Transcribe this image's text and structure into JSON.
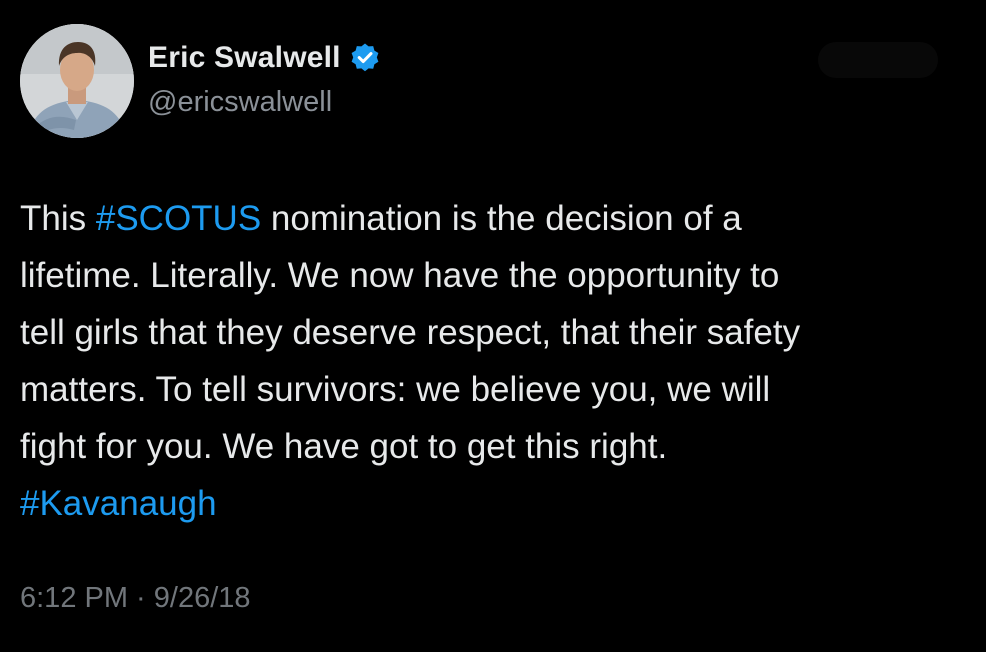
{
  "author": {
    "display_name": "Eric Swalwell",
    "handle": "@ericswalwell",
    "verified": true,
    "verified_icon": "verified-badge-icon"
  },
  "tweet": {
    "lines": [
      [
        {
          "text": "This ",
          "hashtag": false
        },
        {
          "text": "#SCOTUS",
          "hashtag": true
        },
        {
          "text": " nomination is the decision of a",
          "hashtag": false
        }
      ],
      [
        {
          "text": "lifetime. Literally. We now have the opportunity to",
          "hashtag": false
        }
      ],
      [
        {
          "text": "tell girls that they deserve respect, that their safety",
          "hashtag": false
        }
      ],
      [
        {
          "text": "matters. To tell survivors: we believe you, we will",
          "hashtag": false
        }
      ],
      [
        {
          "text": "fight for you. We have got to get this right.",
          "hashtag": false
        }
      ],
      [
        {
          "text": "#Kavanaugh",
          "hashtag": true
        }
      ]
    ],
    "timestamp": "6:12 PM · 9/26/18"
  },
  "colors": {
    "background": "#000000",
    "text": "#e7e9ea",
    "secondary_text": "#71767b",
    "hashtag": "#1d9bf0",
    "verified": "#1d9bf0"
  }
}
